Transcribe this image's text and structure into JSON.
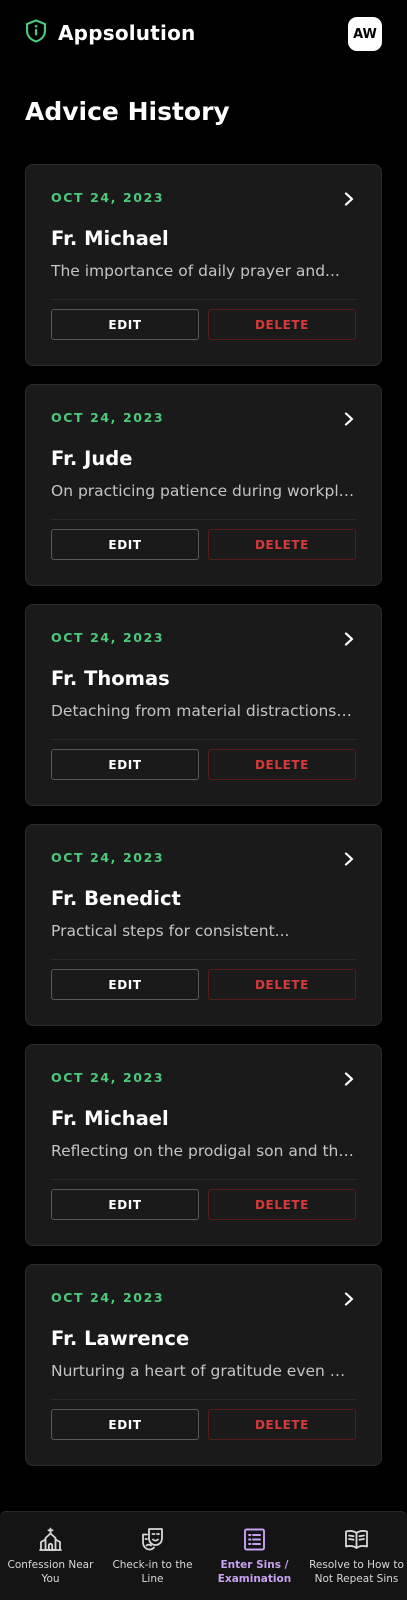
{
  "app": {
    "brand": "Appsolution",
    "avatar_initials": "AW",
    "logo_icon": "shield-icon",
    "accent_color": "#4cc97a"
  },
  "page": {
    "title": "Advice History"
  },
  "cards": [
    {
      "date": "OCT 24, 2023",
      "name": "Fr. Michael",
      "excerpt": "The importance of daily prayer and...",
      "edit_label": "EDIT",
      "delete_label": "DELETE"
    },
    {
      "date": "OCT 24, 2023",
      "name": "Fr. Jude",
      "excerpt": "On practicing patience during workpla...",
      "edit_label": "EDIT",
      "delete_label": "DELETE"
    },
    {
      "date": "OCT 24, 2023",
      "name": "Fr. Thomas",
      "excerpt": "Detaching from material distractions to...",
      "edit_label": "EDIT",
      "delete_label": "DELETE"
    },
    {
      "date": "OCT 24, 2023",
      "name": "Fr. Benedict",
      "excerpt": "Practical steps for consistent...",
      "edit_label": "EDIT",
      "delete_label": "DELETE"
    },
    {
      "date": "OCT 24, 2023",
      "name": "Fr. Michael",
      "excerpt": "Reflecting on the prodigal son and the...",
      "edit_label": "EDIT",
      "delete_label": "DELETE"
    },
    {
      "date": "OCT 24, 2023",
      "name": "Fr. Lawrence",
      "excerpt": "Nurturing a heart of gratitude even wh...",
      "edit_label": "EDIT",
      "delete_label": "DELETE"
    }
  ],
  "nav": {
    "items": [
      {
        "label": "Confession Near You",
        "icon": "church-icon",
        "active": false
      },
      {
        "label": "Check-in to the Line",
        "icon": "theater-masks-icon",
        "active": false
      },
      {
        "label": "Enter Sins / Examination",
        "icon": "list-icon",
        "active": true
      },
      {
        "label": "Resolve to How to Not Repeat Sins",
        "icon": "open-book-icon",
        "active": false
      }
    ],
    "active_color": "#c8a2f0"
  }
}
